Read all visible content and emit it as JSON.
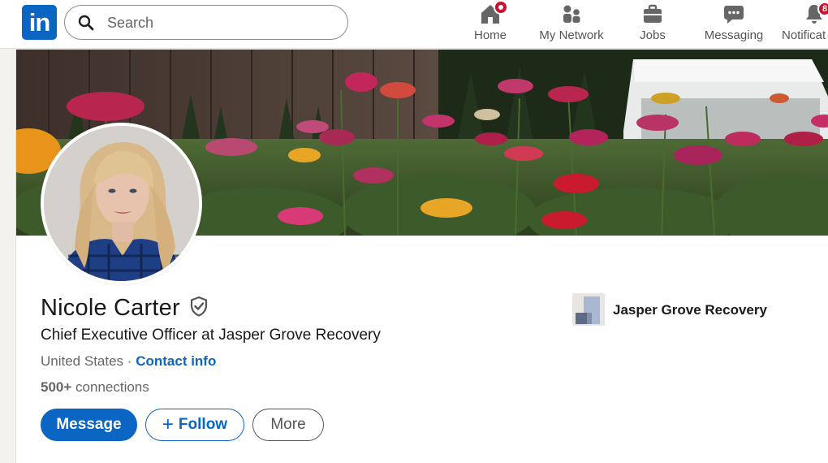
{
  "nav": {
    "logo_text": "in",
    "search_placeholder": "Search",
    "items": [
      {
        "label": "Home",
        "icon": "home-icon",
        "badge": ""
      },
      {
        "label": "My Network",
        "icon": "people-icon",
        "badge": ""
      },
      {
        "label": "Jobs",
        "icon": "briefcase-icon",
        "badge": ""
      },
      {
        "label": "Messaging",
        "icon": "chat-icon",
        "badge": ""
      },
      {
        "label": "Notificat",
        "icon": "bell-icon",
        "badge": "8"
      }
    ]
  },
  "profile": {
    "name": "Nicole Carter",
    "headline": "Chief Executive Officer at Jasper Grove Recovery",
    "location": "United States",
    "separator": "·",
    "contact_info": "Contact info",
    "connections_count": "500+",
    "connections_label": "connections",
    "current_company": "Jasper Grove Recovery"
  },
  "actions": {
    "message": "Message",
    "follow": "Follow",
    "follow_plus": "+",
    "more": "More"
  },
  "colors": {
    "brand": "#0a66c2",
    "badge": "#cb112d",
    "text": "#191919",
    "muted": "#666666"
  }
}
